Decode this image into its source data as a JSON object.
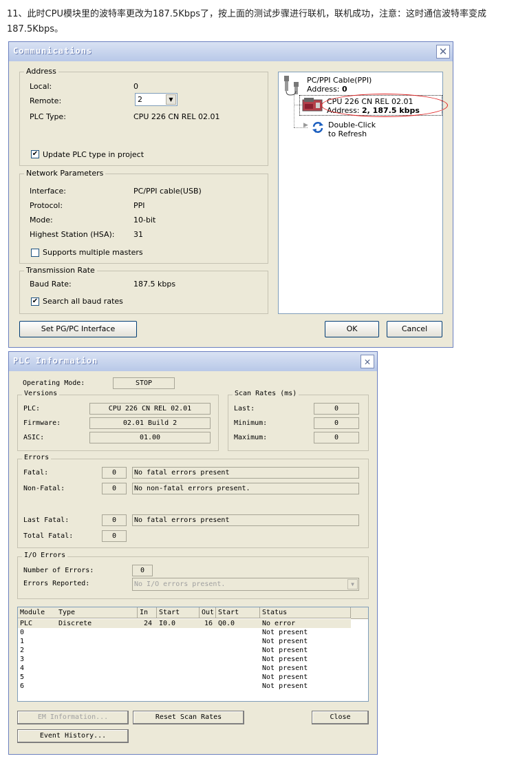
{
  "caption": "11、此时CPU模块里的波特率更改为187.5Kbps了，按上面的测试步骤进行联机，联机成功，注意：这时通信波特率变成187.5Kbps。",
  "communications": {
    "title": "Communications",
    "address": {
      "group_label": "Address",
      "local_label": "Local:",
      "local_value": "0",
      "remote_label": "Remote:",
      "remote_value": "2",
      "plc_type_label": "PLC Type:",
      "plc_type_value": "CPU 226 CN REL 02.01",
      "update_label": "Update PLC type in project",
      "update_checked": true
    },
    "network": {
      "group_label": "Network Parameters",
      "interface_label": "Interface:",
      "interface_value": "PC/PPI cable(USB)",
      "protocol_label": "Protocol:",
      "protocol_value": "PPI",
      "mode_label": "Mode:",
      "mode_value": "10-bit",
      "hsa_label": "Highest Station (HSA):",
      "hsa_value": "31",
      "multi_label": "Supports multiple masters",
      "multi_checked": false
    },
    "transmission": {
      "group_label": "Transmission Rate",
      "baud_label": "Baud Rate:",
      "baud_value": "187.5 kbps",
      "search_label": "Search all baud rates",
      "search_checked": true
    },
    "tree": {
      "cable_name": "PC/PPI Cable(PPI)",
      "cable_addr_label": "Address: ",
      "cable_addr_value": "0",
      "cpu_name": "CPU 226 CN REL 02.01",
      "cpu_addr_label": "Address: ",
      "cpu_addr_value": "2, 187.5 kbps",
      "refresh_line1": "Double-Click",
      "refresh_line2": "to Refresh"
    },
    "buttons": {
      "set_pgpc": "Set PG/PC Interface",
      "ok": "OK",
      "cancel": "Cancel"
    },
    "colors": {
      "highlight_ellipse": "#e02020"
    }
  },
  "plc_info": {
    "title": "PLC Information",
    "operating_mode_label": "Operating Mode:",
    "operating_mode_value": "STOP",
    "versions": {
      "group_label": "Versions",
      "plc_label": "PLC:",
      "plc_value": "CPU 226 CN REL 02.01",
      "firmware_label": "Firmware:",
      "firmware_value": "02.01 Build 2",
      "asic_label": "ASIC:",
      "asic_value": "01.00"
    },
    "scan": {
      "group_label": "Scan Rates (ms)",
      "last_label": "Last:",
      "last_value": "0",
      "min_label": "Minimum:",
      "min_value": "0",
      "max_label": "Maximum:",
      "max_value": "0"
    },
    "errors": {
      "group_label": "Errors",
      "fatal_label": "Fatal:",
      "fatal_count": "0",
      "fatal_text": "No fatal errors present",
      "nonfatal_label": "Non-Fatal:",
      "nonfatal_count": "0",
      "nonfatal_text": "No non-fatal errors present.",
      "lastfatal_label": "Last Fatal:",
      "lastfatal_count": "0",
      "lastfatal_text": "No fatal errors present",
      "totalfatal_label": "Total Fatal:",
      "totalfatal_count": "0"
    },
    "io_errors": {
      "group_label": "I/O Errors",
      "count_label": "Number of Errors:",
      "count_value": "0",
      "reported_label": "Errors Reported:",
      "reported_value": "No I/O errors present."
    },
    "table": {
      "headers": [
        "Module",
        "Type",
        "In",
        "Start",
        "Out",
        "Start",
        "Status"
      ],
      "rows": [
        [
          "PLC",
          "Discrete",
          "24",
          "I0.0",
          "16",
          "Q0.0",
          "No error"
        ],
        [
          "0",
          "",
          "",
          "",
          "",
          "",
          "Not present"
        ],
        [
          "1",
          "",
          "",
          "",
          "",
          "",
          "Not present"
        ],
        [
          "2",
          "",
          "",
          "",
          "",
          "",
          "Not present"
        ],
        [
          "3",
          "",
          "",
          "",
          "",
          "",
          "Not present"
        ],
        [
          "4",
          "",
          "",
          "",
          "",
          "",
          "Not present"
        ],
        [
          "5",
          "",
          "",
          "",
          "",
          "",
          "Not present"
        ],
        [
          "6",
          "",
          "",
          "",
          "",
          "",
          "Not present"
        ]
      ]
    },
    "buttons": {
      "em_info": "EM Information...",
      "reset_scan": "Reset Scan Rates",
      "close": "Close",
      "event_history": "Event History..."
    }
  }
}
